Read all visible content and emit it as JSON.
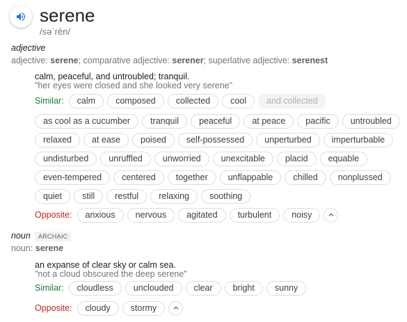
{
  "word": "serene",
  "pronunciation": "/səˈrēn/",
  "adjective": {
    "pos": "adjective",
    "forms_prefix": "adjective: ",
    "base": "serene",
    "comparative_label": "; comparative adjective: ",
    "comparative": "serener",
    "superlative_label": "; superlative adjective: ",
    "superlative": "serenest",
    "definition": "calm, peaceful, and untroubled; tranquil.",
    "example": "\"her eyes were closed and she looked very serene\"",
    "similar_label": "Similar:",
    "similar_rows": [
      [
        "calm",
        "composed",
        "collected",
        "cool"
      ],
      [
        "as cool as a cucumber",
        "tranquil",
        "peaceful",
        "at peace",
        "pacific",
        "untroubled"
      ],
      [
        "relaxed",
        "at ease",
        "poised",
        "self-possessed",
        "unperturbed",
        "imperturbable"
      ],
      [
        "undisturbed",
        "unruffled",
        "unworried",
        "unexcitable",
        "placid",
        "equable"
      ],
      [
        "even-tempered",
        "centered",
        "together",
        "unflappable",
        "chilled",
        "nonplussed"
      ],
      [
        "quiet",
        "still",
        "restful",
        "relaxing",
        "soothing"
      ]
    ],
    "similar_faded": "and collected",
    "opposite_label": "Opposite:",
    "opposites": [
      "anxious",
      "nervous",
      "agitated",
      "turbulent",
      "noisy"
    ]
  },
  "noun": {
    "pos": "noun",
    "badge": "ARCHAIC",
    "forms_prefix": "noun: ",
    "base": "serene",
    "definition": "an expanse of clear sky or calm sea.",
    "example": "\"not a cloud obscured the deep serene\"",
    "similar_label": "Similar:",
    "similar": [
      "cloudless",
      "unclouded",
      "clear",
      "bright",
      "sunny"
    ],
    "opposite_label": "Opposite:",
    "opposites": [
      "cloudy",
      "stormy"
    ]
  },
  "colors": {
    "similar": "#188038",
    "opposite": "#c5221f",
    "icon": "#1a73e8"
  }
}
